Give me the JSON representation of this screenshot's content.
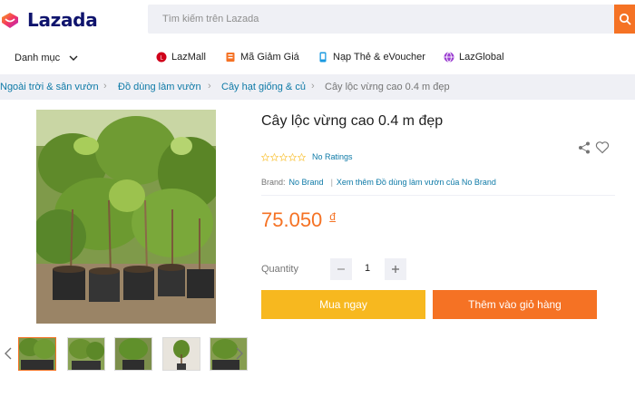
{
  "header": {
    "logo_text": "Lazada",
    "search_placeholder": "Tìm kiếm trên Lazada"
  },
  "nav": {
    "category_label": "Danh mục",
    "links": [
      {
        "label": "LazMall",
        "icon": "lazmall-icon"
      },
      {
        "label": "Mã Giảm Giá",
        "icon": "voucher-icon"
      },
      {
        "label": "Nạp Thẻ & eVoucher",
        "icon": "topup-icon"
      },
      {
        "label": "LazGlobal",
        "icon": "lazglobal-icon"
      }
    ]
  },
  "breadcrumb": {
    "items": [
      "Ngoài trời & sân vườn",
      "Đồ dùng làm vườn",
      "Cây hạt giống & củ"
    ],
    "current": "Cây lộc vừng cao 0.4 m đẹp"
  },
  "product": {
    "title": "Cây lộc vừng cao 0.4 m đẹp",
    "rating_stars": 0,
    "ratings_text": "No Ratings",
    "brand_label": "Brand:",
    "brand_name": "No Brand",
    "more_link": "Xem thêm Đồ dùng làm vườn của No Brand",
    "price": "75.050",
    "currency": "đ",
    "quantity_label": "Quantity",
    "quantity_value": "1",
    "buy_now_label": "Mua ngay",
    "add_to_cart_label": "Thêm vào giỏ hàng",
    "thumbnail_count": 5
  },
  "colors": {
    "brand_orange": "#f57224",
    "buy_yellow": "#f7b81f",
    "link_blue": "#0e7aa7",
    "logo_navy": "#0f146d"
  }
}
